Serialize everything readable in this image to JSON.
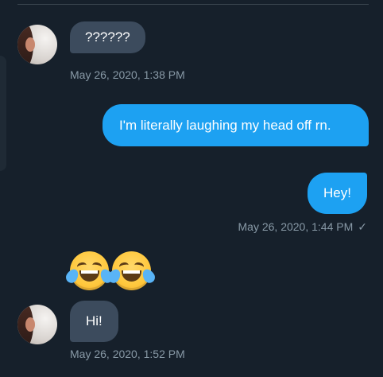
{
  "messages": [
    {
      "id": "m1",
      "direction": "incoming",
      "text": "??????",
      "timestamp": "May 26, 2020, 1:38 PM"
    },
    {
      "id": "m2",
      "direction": "outgoing",
      "text": "I'm literally laughing my head off rn."
    },
    {
      "id": "m3",
      "direction": "outgoing",
      "text": "Hey!",
      "timestamp": "May 26, 2020, 1:44 PM",
      "status_icon": "check-icon",
      "status_glyph": "✓"
    },
    {
      "id": "m4",
      "direction": "incoming",
      "emoji": [
        "face-with-tears-of-joy-icon",
        "face-with-tears-of-joy-icon"
      ]
    },
    {
      "id": "m5",
      "direction": "incoming",
      "text": "Hi!",
      "timestamp": "May 26, 2020, 1:52 PM"
    }
  ],
  "colors": {
    "background": "#16202b",
    "incoming_bubble": "#3c4b5d",
    "outgoing_bubble": "#1da1f2",
    "timestamp": "#8899a6"
  }
}
